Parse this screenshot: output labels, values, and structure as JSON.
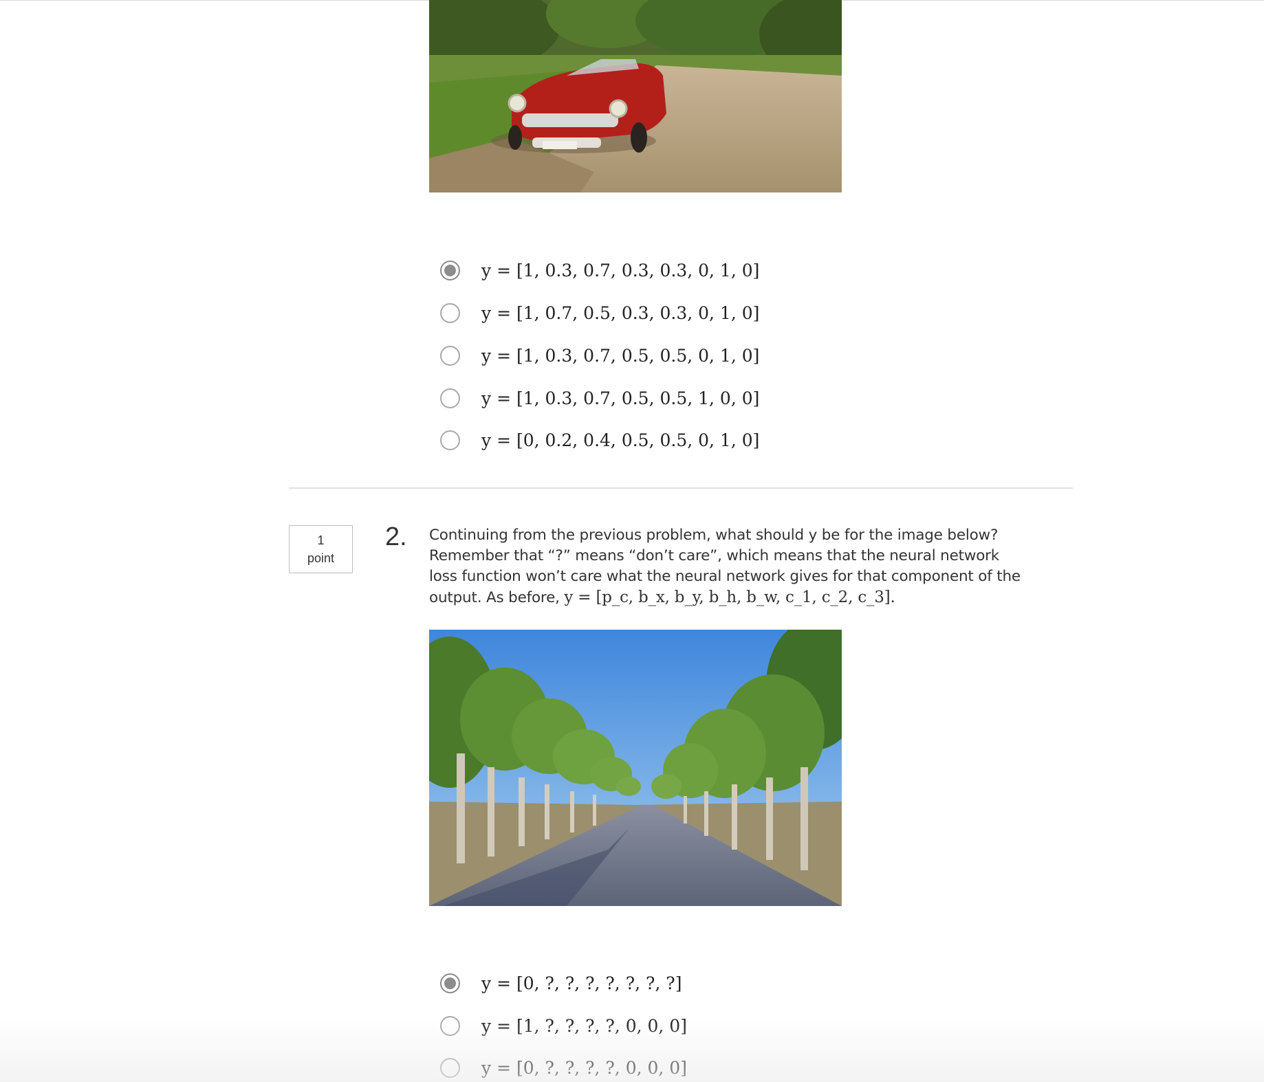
{
  "question1": {
    "options": [
      {
        "label": "y = [1, 0.3, 0.7, 0.3, 0.3, 0, 1, 0]",
        "selected": true
      },
      {
        "label": "y = [1, 0.7, 0.5, 0.3, 0.3, 0, 1, 0]",
        "selected": false
      },
      {
        "label": "y = [1, 0.3, 0.7, 0.5, 0.5, 0, 1, 0]",
        "selected": false
      },
      {
        "label": "y = [1, 0.3, 0.7, 0.5, 0.5, 1, 0, 0]",
        "selected": false
      },
      {
        "label": "y = [0, 0.2, 0.4, 0.5, 0.5, 0, 1, 0]",
        "selected": false
      }
    ]
  },
  "question2": {
    "points_value": "1",
    "points_unit": "point",
    "number": "2.",
    "text": "Continuing from the previous problem, what should y be for the image below? Remember that “?” means “don’t care”, which means that the neural network loss function won’t care what the neural network gives for that component of the output. As before,",
    "formula": "y = [p_c, b_x, b_y, b_h, b_w, c_1, c_2, c_3].",
    "options": [
      {
        "label": "y = [0, ?, ?, ?, ?, ?, ?, ?]",
        "selected": true
      },
      {
        "label": "y = [1, ?, ?, ?, ?, 0, 0, 0]",
        "selected": false
      },
      {
        "label": "y = [0, ?, ?, ?, ?, 0, 0, 0]",
        "selected": false
      }
    ]
  }
}
